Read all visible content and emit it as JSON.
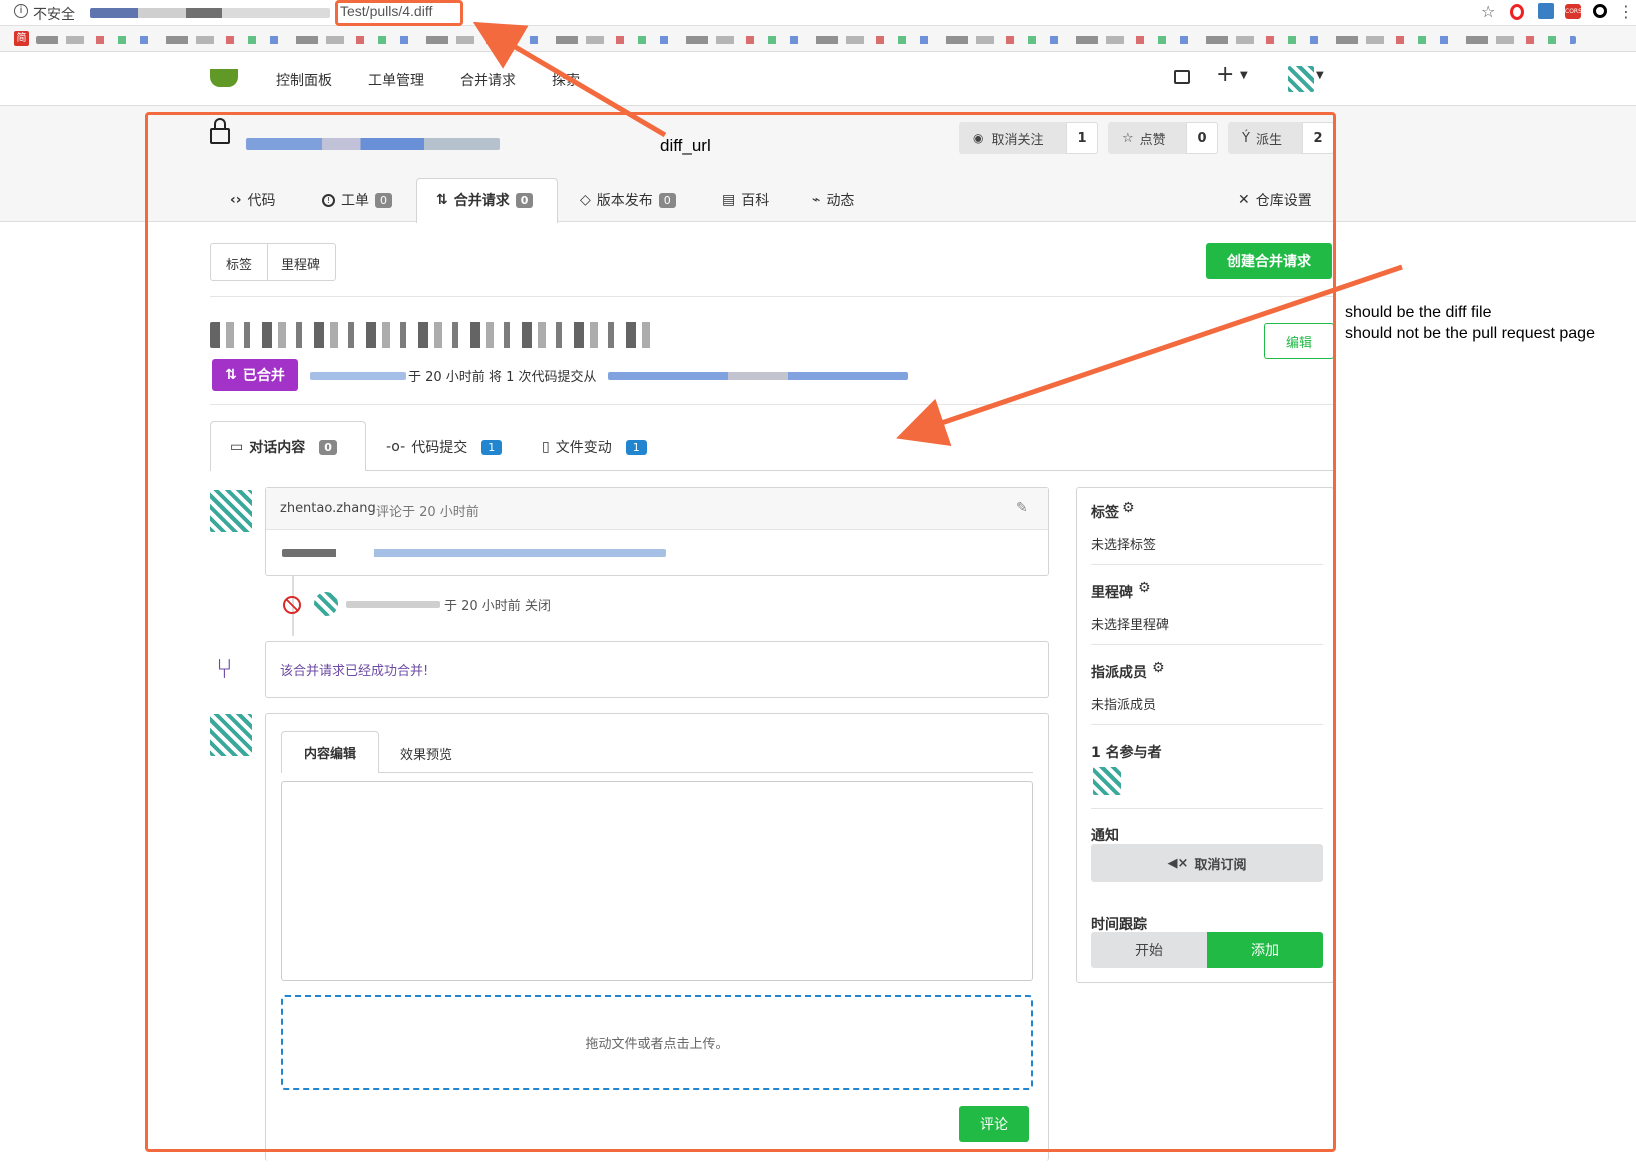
{
  "browser": {
    "security_label": "不安全",
    "url_visible": "Test/pulls/4.diff",
    "bookmark_first": "简"
  },
  "nav": {
    "items": [
      "控制面板",
      "工单管理",
      "合并请求",
      "探索"
    ]
  },
  "repo": {
    "watch_label": "取消关注",
    "watch_count": "1",
    "star_label": "点赞",
    "star_count": "0",
    "fork_label": "派生",
    "fork_count": "2",
    "tabs": [
      {
        "label": "代码"
      },
      {
        "label": "工单",
        "count": "0"
      },
      {
        "label": "合并请求",
        "count": "0"
      },
      {
        "label": "版本发布",
        "count": "0"
      },
      {
        "label": "百科"
      },
      {
        "label": "动态"
      }
    ],
    "settings_label": "仓库设置"
  },
  "filters": {
    "labels_btn": "标签",
    "milestones_btn": "里程碑",
    "create_pr_btn": "创建合并请求"
  },
  "pr": {
    "edit_btn": "编辑",
    "status_label": "已合并",
    "meta_text": "于 20 小时前 将 1 次代码提交从",
    "tabs": [
      {
        "label": "对话内容",
        "count": "0"
      },
      {
        "label": "代码提交",
        "count": "1"
      },
      {
        "label": "文件变动",
        "count": "1"
      }
    ]
  },
  "timeline": {
    "comment_author": "zhentao.zhang",
    "comment_meta": "评论于 20 小时前",
    "closed_text": "于 20 小时前 关闭",
    "merged_text": "该合并请求已经成功合并!",
    "editor_tab_write": "内容编辑",
    "editor_tab_preview": "效果预览",
    "dropzone_text": "拖动文件或者点击上传。",
    "comment_btn": "评论"
  },
  "sidebar": {
    "labels_title": "标签",
    "labels_value": "未选择标签",
    "milestone_title": "里程碑",
    "milestone_value": "未选择里程碑",
    "assignees_title": "指派成员",
    "assignees_value": "未指派成员",
    "participants_title": "1 名参与者",
    "notify_title": "通知",
    "unsubscribe_btn": "取消订阅",
    "tracking_title": "时间跟踪",
    "start_btn": "开始",
    "add_btn": "添加"
  },
  "annotations": {
    "diff_url": "diff_url",
    "note_line1": "should be the diff file",
    "note_line2": "should not be the pull request page"
  },
  "colors": {
    "annotation": "#f26a3d",
    "green": "#21ba45",
    "purple": "#a333c8",
    "blue": "#2185d0"
  }
}
